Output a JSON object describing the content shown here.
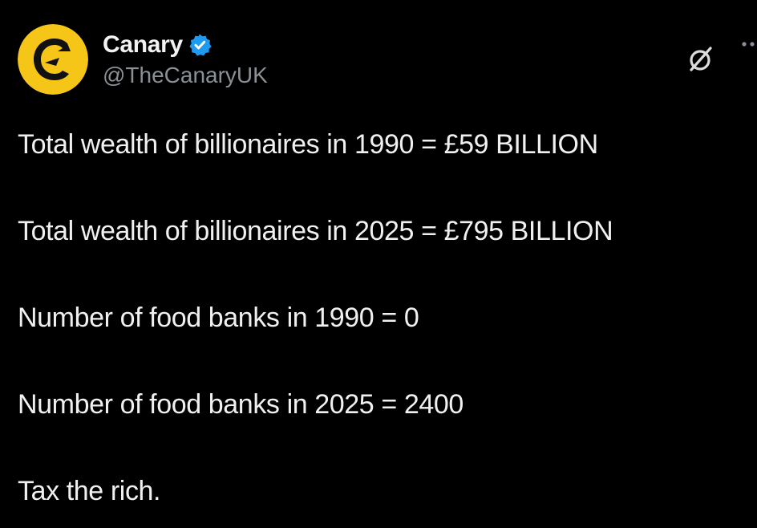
{
  "account": {
    "display_name": "Canary",
    "handle": "@TheCanaryUK",
    "verified": true
  },
  "icons": {
    "avatar": "canary-logo",
    "verified": "verified-badge-icon",
    "grok": "grok-icon",
    "more": "more-options-icon"
  },
  "colors": {
    "background": "#000000",
    "avatar_yellow": "#f5c518",
    "verified_blue": "#1d9bf0",
    "handle_gray": "#8b9096"
  },
  "post": {
    "lines": [
      "Total wealth of billionaires in 1990 = £59 BILLION",
      "Total wealth of billionaires in 2025 = £795 BILLION",
      "Number of food banks in 1990 = 0",
      "Number of food banks in 2025 = 2400",
      "Tax the rich."
    ]
  }
}
